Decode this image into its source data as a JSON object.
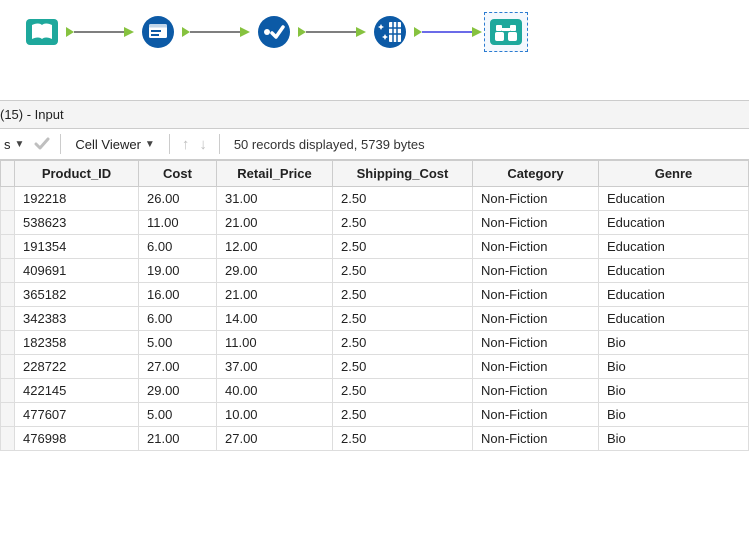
{
  "panel": {
    "title": "(15) - Input"
  },
  "toolbar": {
    "s_label": "s",
    "cell_viewer_label": "Cell Viewer",
    "status": "50 records displayed, 5739 bytes"
  },
  "table": {
    "headers": {
      "product_id": "Product_ID",
      "cost": "Cost",
      "retail_price": "Retail_Price",
      "shipping_cost": "Shipping_Cost",
      "category": "Category",
      "genre": "Genre"
    },
    "rows": [
      {
        "product_id": "192218",
        "cost": "26.00",
        "retail_price": "31.00",
        "shipping_cost": "2.50",
        "category": "Non-Fiction",
        "genre": "Education"
      },
      {
        "product_id": "538623",
        "cost": "11.00",
        "retail_price": "21.00",
        "shipping_cost": "2.50",
        "category": "Non-Fiction",
        "genre": "Education"
      },
      {
        "product_id": "191354",
        "cost": "6.00",
        "retail_price": "12.00",
        "shipping_cost": "2.50",
        "category": "Non-Fiction",
        "genre": "Education"
      },
      {
        "product_id": "409691",
        "cost": "19.00",
        "retail_price": "29.00",
        "shipping_cost": "2.50",
        "category": "Non-Fiction",
        "genre": "Education"
      },
      {
        "product_id": "365182",
        "cost": "16.00",
        "retail_price": "21.00",
        "shipping_cost": "2.50",
        "category": "Non-Fiction",
        "genre": "Education"
      },
      {
        "product_id": "342383",
        "cost": "6.00",
        "retail_price": "14.00",
        "shipping_cost": "2.50",
        "category": "Non-Fiction",
        "genre": "Education"
      },
      {
        "product_id": "182358",
        "cost": "5.00",
        "retail_price": "11.00",
        "shipping_cost": "2.50",
        "category": "Non-Fiction",
        "genre": "Bio"
      },
      {
        "product_id": "228722",
        "cost": "27.00",
        "retail_price": "37.00",
        "shipping_cost": "2.50",
        "category": "Non-Fiction",
        "genre": "Bio"
      },
      {
        "product_id": "422145",
        "cost": "29.00",
        "retail_price": "40.00",
        "shipping_cost": "2.50",
        "category": "Non-Fiction",
        "genre": "Bio"
      },
      {
        "product_id": "477607",
        "cost": "5.00",
        "retail_price": "10.00",
        "shipping_cost": "2.50",
        "category": "Non-Fiction",
        "genre": "Bio"
      },
      {
        "product_id": "476998",
        "cost": "21.00",
        "retail_price": "27.00",
        "shipping_cost": "2.50",
        "category": "Non-Fiction",
        "genre": "Bio"
      }
    ]
  }
}
